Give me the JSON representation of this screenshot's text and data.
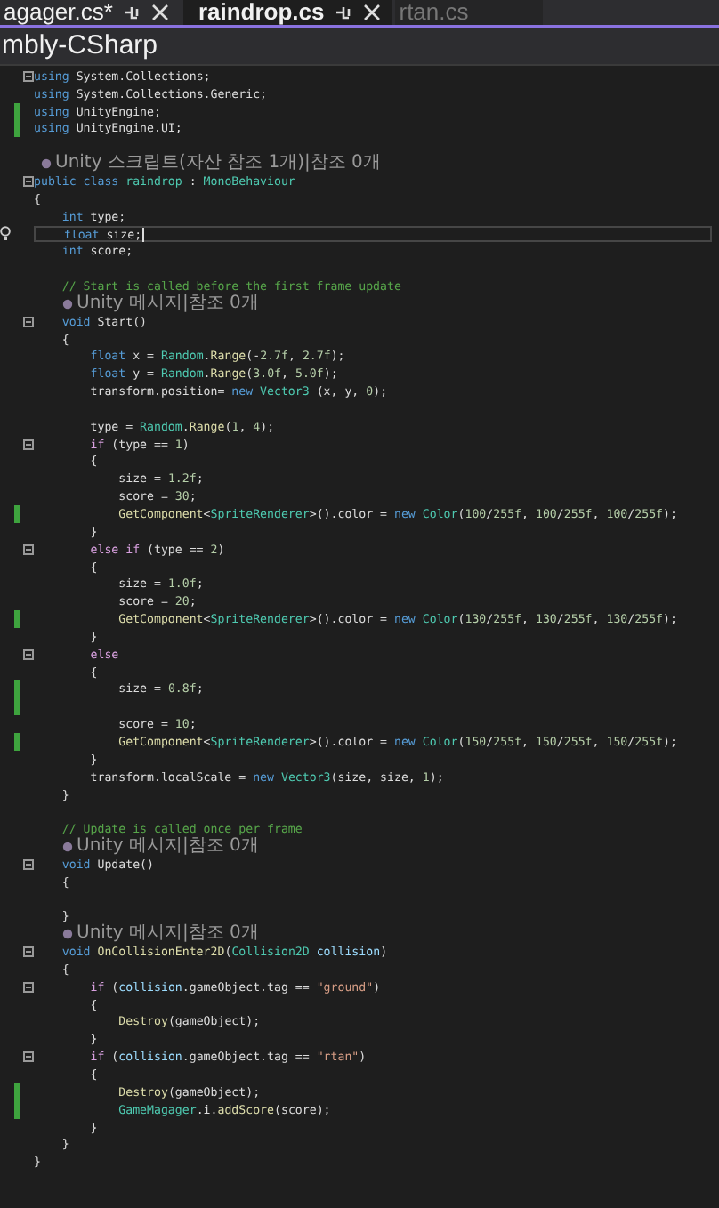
{
  "tabs": [
    {
      "label": "agager.cs*",
      "selected": false,
      "controls": true
    },
    {
      "label": "raindrop.cs",
      "selected": true,
      "controls": true
    },
    {
      "label": "rtan.cs",
      "selected": false,
      "controls": false
    }
  ],
  "project": "mbly-CSharp",
  "lines": [
    {
      "kind": "code",
      "fold": true,
      "changed": false,
      "current": false,
      "tokens": [
        {
          "kind": "kw",
          "text": "using"
        },
        {
          "kind": "plain",
          "text": " System.Collections;"
        }
      ]
    },
    {
      "kind": "code",
      "fold": false,
      "changed": false,
      "current": false,
      "tokens": [
        {
          "kind": "kw",
          "text": "using"
        },
        {
          "kind": "plain",
          "text": " System.Collections.Generic;"
        }
      ]
    },
    {
      "kind": "code",
      "fold": false,
      "changed": true,
      "current": false,
      "tokens": [
        {
          "kind": "kw",
          "text": "using"
        },
        {
          "kind": "plain",
          "text": " UnityEngine;"
        }
      ]
    },
    {
      "kind": "code",
      "fold": false,
      "changed": true,
      "current": false,
      "tokens": [
        {
          "kind": "kw",
          "text": "using"
        },
        {
          "kind": "plain",
          "text": " UnityEngine.UI;"
        }
      ]
    },
    {
      "kind": "blank"
    },
    {
      "kind": "lens",
      "text": " Unity 스크립트(자산 참조 1개)|참조 0개"
    },
    {
      "kind": "code",
      "fold": true,
      "changed": false,
      "current": false,
      "tokens": [
        {
          "kind": "kw",
          "text": "public class "
        },
        {
          "kind": "type",
          "text": "raindrop"
        },
        {
          "kind": "plain",
          "text": " : "
        },
        {
          "kind": "type",
          "text": "MonoBehaviour"
        }
      ]
    },
    {
      "kind": "code",
      "fold": false,
      "changed": false,
      "current": false,
      "tokens": [
        {
          "kind": "plain",
          "text": "{"
        }
      ]
    },
    {
      "kind": "code",
      "fold": false,
      "changed": false,
      "current": false,
      "tokens": [
        {
          "kind": "kw",
          "text": "    int"
        },
        {
          "kind": "plain",
          "text": " type;"
        }
      ]
    },
    {
      "kind": "code",
      "fold": false,
      "changed": false,
      "current": true,
      "tokens": [
        {
          "kind": "kw",
          "text": "    float"
        },
        {
          "kind": "plain",
          "text": " size;"
        }
      ]
    },
    {
      "kind": "code",
      "fold": false,
      "changed": false,
      "current": false,
      "tokens": [
        {
          "kind": "kw",
          "text": "    int"
        },
        {
          "kind": "plain",
          "text": " score;"
        }
      ]
    },
    {
      "kind": "blank"
    },
    {
      "kind": "code",
      "fold": false,
      "changed": false,
      "current": false,
      "tokens": [
        {
          "kind": "comment",
          "text": "    // Start is called before the first frame update"
        }
      ]
    },
    {
      "kind": "lens",
      "text": "    Unity 메시지|참조 0개"
    },
    {
      "kind": "code",
      "fold": true,
      "changed": false,
      "current": false,
      "tokens": [
        {
          "kind": "kw",
          "text": "    void"
        },
        {
          "kind": "plain",
          "text": " Start()"
        }
      ]
    },
    {
      "kind": "code",
      "fold": false,
      "changed": false,
      "current": false,
      "tokens": [
        {
          "kind": "plain",
          "text": "    {"
        }
      ]
    },
    {
      "kind": "code",
      "fold": false,
      "changed": false,
      "current": false,
      "tokens": [
        {
          "kind": "kw",
          "text": "        float"
        },
        {
          "kind": "plain",
          "text": " x = "
        },
        {
          "kind": "type",
          "text": "Random"
        },
        {
          "kind": "plain",
          "text": "."
        },
        {
          "kind": "fn",
          "text": "Range"
        },
        {
          "kind": "plain",
          "text": "(-"
        },
        {
          "kind": "num",
          "text": "2.7f"
        },
        {
          "kind": "plain",
          "text": ", "
        },
        {
          "kind": "num",
          "text": "2.7f"
        },
        {
          "kind": "plain",
          "text": ");"
        }
      ]
    },
    {
      "kind": "code",
      "fold": false,
      "changed": false,
      "current": false,
      "tokens": [
        {
          "kind": "kw",
          "text": "        float"
        },
        {
          "kind": "plain",
          "text": " y = "
        },
        {
          "kind": "type",
          "text": "Random"
        },
        {
          "kind": "plain",
          "text": "."
        },
        {
          "kind": "fn",
          "text": "Range"
        },
        {
          "kind": "plain",
          "text": "("
        },
        {
          "kind": "num",
          "text": "3.0f"
        },
        {
          "kind": "plain",
          "text": ", "
        },
        {
          "kind": "num",
          "text": "5.0f"
        },
        {
          "kind": "plain",
          "text": ");"
        }
      ]
    },
    {
      "kind": "code",
      "fold": false,
      "changed": false,
      "current": false,
      "tokens": [
        {
          "kind": "plain",
          "text": "        transform.position= "
        },
        {
          "kind": "kw",
          "text": "new "
        },
        {
          "kind": "type",
          "text": "Vector3"
        },
        {
          "kind": "plain",
          "text": " (x, y, "
        },
        {
          "kind": "num",
          "text": "0"
        },
        {
          "kind": "plain",
          "text": ");"
        }
      ]
    },
    {
      "kind": "blank"
    },
    {
      "kind": "code",
      "fold": false,
      "changed": false,
      "current": false,
      "tokens": [
        {
          "kind": "plain",
          "text": "        type = "
        },
        {
          "kind": "type",
          "text": "Random"
        },
        {
          "kind": "plain",
          "text": "."
        },
        {
          "kind": "fn",
          "text": "Range"
        },
        {
          "kind": "plain",
          "text": "("
        },
        {
          "kind": "num",
          "text": "1"
        },
        {
          "kind": "plain",
          "text": ", "
        },
        {
          "kind": "num",
          "text": "4"
        },
        {
          "kind": "plain",
          "text": ");"
        }
      ]
    },
    {
      "kind": "code",
      "fold": true,
      "changed": false,
      "current": false,
      "tokens": [
        {
          "kind": "control",
          "text": "        if"
        },
        {
          "kind": "plain",
          "text": " (type == "
        },
        {
          "kind": "num",
          "text": "1"
        },
        {
          "kind": "plain",
          "text": ")"
        }
      ]
    },
    {
      "kind": "code",
      "fold": false,
      "changed": false,
      "current": false,
      "tokens": [
        {
          "kind": "plain",
          "text": "        {"
        }
      ]
    },
    {
      "kind": "code",
      "fold": false,
      "changed": false,
      "current": false,
      "tokens": [
        {
          "kind": "plain",
          "text": "            size = "
        },
        {
          "kind": "num",
          "text": "1.2f"
        },
        {
          "kind": "plain",
          "text": ";"
        }
      ]
    },
    {
      "kind": "code",
      "fold": false,
      "changed": false,
      "current": false,
      "tokens": [
        {
          "kind": "plain",
          "text": "            score = "
        },
        {
          "kind": "num",
          "text": "30"
        },
        {
          "kind": "plain",
          "text": ";"
        }
      ]
    },
    {
      "kind": "code",
      "fold": false,
      "changed": true,
      "current": false,
      "tokens": [
        {
          "kind": "fn",
          "text": "            GetComponent"
        },
        {
          "kind": "plain",
          "text": "<"
        },
        {
          "kind": "type",
          "text": "SpriteRenderer"
        },
        {
          "kind": "plain",
          "text": ">().color = "
        },
        {
          "kind": "kw",
          "text": "new "
        },
        {
          "kind": "type",
          "text": "Color"
        },
        {
          "kind": "plain",
          "text": "("
        },
        {
          "kind": "num",
          "text": "100"
        },
        {
          "kind": "plain",
          "text": "/"
        },
        {
          "kind": "num",
          "text": "255f"
        },
        {
          "kind": "plain",
          "text": ", "
        },
        {
          "kind": "num",
          "text": "100"
        },
        {
          "kind": "plain",
          "text": "/"
        },
        {
          "kind": "num",
          "text": "255f"
        },
        {
          "kind": "plain",
          "text": ", "
        },
        {
          "kind": "num",
          "text": "100"
        },
        {
          "kind": "plain",
          "text": "/"
        },
        {
          "kind": "num",
          "text": "255f"
        },
        {
          "kind": "plain",
          "text": ");"
        }
      ]
    },
    {
      "kind": "code",
      "fold": false,
      "changed": false,
      "current": false,
      "tokens": [
        {
          "kind": "plain",
          "text": "        }"
        }
      ]
    },
    {
      "kind": "code",
      "fold": true,
      "changed": false,
      "current": false,
      "tokens": [
        {
          "kind": "control",
          "text": "        else if"
        },
        {
          "kind": "plain",
          "text": " (type == "
        },
        {
          "kind": "num",
          "text": "2"
        },
        {
          "kind": "plain",
          "text": ")"
        }
      ]
    },
    {
      "kind": "code",
      "fold": false,
      "changed": false,
      "current": false,
      "tokens": [
        {
          "kind": "plain",
          "text": "        {"
        }
      ]
    },
    {
      "kind": "code",
      "fold": false,
      "changed": false,
      "current": false,
      "tokens": [
        {
          "kind": "plain",
          "text": "            size = "
        },
        {
          "kind": "num",
          "text": "1.0f"
        },
        {
          "kind": "plain",
          "text": ";"
        }
      ]
    },
    {
      "kind": "code",
      "fold": false,
      "changed": false,
      "current": false,
      "tokens": [
        {
          "kind": "plain",
          "text": "            score = "
        },
        {
          "kind": "num",
          "text": "20"
        },
        {
          "kind": "plain",
          "text": ";"
        }
      ]
    },
    {
      "kind": "code",
      "fold": false,
      "changed": true,
      "current": false,
      "tokens": [
        {
          "kind": "fn",
          "text": "            GetComponent"
        },
        {
          "kind": "plain",
          "text": "<"
        },
        {
          "kind": "type",
          "text": "SpriteRenderer"
        },
        {
          "kind": "plain",
          "text": ">().color = "
        },
        {
          "kind": "kw",
          "text": "new "
        },
        {
          "kind": "type",
          "text": "Color"
        },
        {
          "kind": "plain",
          "text": "("
        },
        {
          "kind": "num",
          "text": "130"
        },
        {
          "kind": "plain",
          "text": "/"
        },
        {
          "kind": "num",
          "text": "255f"
        },
        {
          "kind": "plain",
          "text": ", "
        },
        {
          "kind": "num",
          "text": "130"
        },
        {
          "kind": "plain",
          "text": "/"
        },
        {
          "kind": "num",
          "text": "255f"
        },
        {
          "kind": "plain",
          "text": ", "
        },
        {
          "kind": "num",
          "text": "130"
        },
        {
          "kind": "plain",
          "text": "/"
        },
        {
          "kind": "num",
          "text": "255f"
        },
        {
          "kind": "plain",
          "text": ");"
        }
      ]
    },
    {
      "kind": "code",
      "fold": false,
      "changed": false,
      "current": false,
      "tokens": [
        {
          "kind": "plain",
          "text": "        }"
        }
      ]
    },
    {
      "kind": "code",
      "fold": true,
      "changed": false,
      "current": false,
      "tokens": [
        {
          "kind": "control",
          "text": "        else"
        }
      ]
    },
    {
      "kind": "code",
      "fold": false,
      "changed": false,
      "current": false,
      "tokens": [
        {
          "kind": "plain",
          "text": "        {"
        }
      ]
    },
    {
      "kind": "code",
      "fold": false,
      "changed": true,
      "current": false,
      "tokens": [
        {
          "kind": "plain",
          "text": "            size = "
        },
        {
          "kind": "num",
          "text": "0.8f"
        },
        {
          "kind": "plain",
          "text": ";"
        }
      ]
    },
    {
      "kind": "blank",
      "changed": true
    },
    {
      "kind": "code",
      "fold": false,
      "changed": false,
      "current": false,
      "tokens": [
        {
          "kind": "plain",
          "text": "            score = "
        },
        {
          "kind": "num",
          "text": "10"
        },
        {
          "kind": "plain",
          "text": ";"
        }
      ]
    },
    {
      "kind": "code",
      "fold": false,
      "changed": true,
      "current": false,
      "tokens": [
        {
          "kind": "fn",
          "text": "            GetComponent"
        },
        {
          "kind": "plain",
          "text": "<"
        },
        {
          "kind": "type",
          "text": "SpriteRenderer"
        },
        {
          "kind": "plain",
          "text": ">().color = "
        },
        {
          "kind": "kw",
          "text": "new "
        },
        {
          "kind": "type",
          "text": "Color"
        },
        {
          "kind": "plain",
          "text": "("
        },
        {
          "kind": "num",
          "text": "150"
        },
        {
          "kind": "plain",
          "text": "/"
        },
        {
          "kind": "num",
          "text": "255f"
        },
        {
          "kind": "plain",
          "text": ", "
        },
        {
          "kind": "num",
          "text": "150"
        },
        {
          "kind": "plain",
          "text": "/"
        },
        {
          "kind": "num",
          "text": "255f"
        },
        {
          "kind": "plain",
          "text": ", "
        },
        {
          "kind": "num",
          "text": "150"
        },
        {
          "kind": "plain",
          "text": "/"
        },
        {
          "kind": "num",
          "text": "255f"
        },
        {
          "kind": "plain",
          "text": ");"
        }
      ]
    },
    {
      "kind": "code",
      "fold": false,
      "changed": false,
      "current": false,
      "tokens": [
        {
          "kind": "plain",
          "text": "        }"
        }
      ]
    },
    {
      "kind": "code",
      "fold": false,
      "changed": false,
      "current": false,
      "tokens": [
        {
          "kind": "plain",
          "text": "        transform.localScale = "
        },
        {
          "kind": "kw",
          "text": "new "
        },
        {
          "kind": "type",
          "text": "Vector3"
        },
        {
          "kind": "plain",
          "text": "(size, size, "
        },
        {
          "kind": "num",
          "text": "1"
        },
        {
          "kind": "plain",
          "text": ");"
        }
      ]
    },
    {
      "kind": "code",
      "fold": false,
      "changed": false,
      "current": false,
      "tokens": [
        {
          "kind": "plain",
          "text": "    }"
        }
      ]
    },
    {
      "kind": "blank"
    },
    {
      "kind": "code",
      "fold": false,
      "changed": false,
      "current": false,
      "tokens": [
        {
          "kind": "comment",
          "text": "    // Update is called once per frame"
        }
      ]
    },
    {
      "kind": "lens",
      "text": "    Unity 메시지|참조 0개"
    },
    {
      "kind": "code",
      "fold": true,
      "changed": false,
      "current": false,
      "tokens": [
        {
          "kind": "kw",
          "text": "    void"
        },
        {
          "kind": "plain",
          "text": " Update()"
        }
      ]
    },
    {
      "kind": "code",
      "fold": false,
      "changed": false,
      "current": false,
      "tokens": [
        {
          "kind": "plain",
          "text": "    {"
        }
      ]
    },
    {
      "kind": "blank"
    },
    {
      "kind": "code",
      "fold": false,
      "changed": false,
      "current": false,
      "tokens": [
        {
          "kind": "plain",
          "text": "    }"
        }
      ]
    },
    {
      "kind": "lens",
      "text": "    Unity 메시지|참조 0개"
    },
    {
      "kind": "code",
      "fold": true,
      "changed": false,
      "current": false,
      "tokens": [
        {
          "kind": "kw",
          "text": "    void"
        },
        {
          "kind": "fn",
          "text": " OnCollisionEnter2D"
        },
        {
          "kind": "plain",
          "text": "("
        },
        {
          "kind": "type",
          "text": "Collision2D"
        },
        {
          "kind": "var",
          "text": " collision"
        },
        {
          "kind": "plain",
          "text": ")"
        }
      ]
    },
    {
      "kind": "code",
      "fold": false,
      "changed": false,
      "current": false,
      "tokens": [
        {
          "kind": "plain",
          "text": "    {"
        }
      ]
    },
    {
      "kind": "code",
      "fold": true,
      "changed": false,
      "current": false,
      "tokens": [
        {
          "kind": "control",
          "text": "        if"
        },
        {
          "kind": "plain",
          "text": " ("
        },
        {
          "kind": "var",
          "text": "collision"
        },
        {
          "kind": "plain",
          "text": ".gameObject.tag == "
        },
        {
          "kind": "string",
          "text": "\"ground\""
        },
        {
          "kind": "plain",
          "text": ")"
        }
      ]
    },
    {
      "kind": "code",
      "fold": false,
      "changed": false,
      "current": false,
      "tokens": [
        {
          "kind": "plain",
          "text": "        {"
        }
      ]
    },
    {
      "kind": "code",
      "fold": false,
      "changed": false,
      "current": false,
      "tokens": [
        {
          "kind": "fn",
          "text": "            Destroy"
        },
        {
          "kind": "plain",
          "text": "(gameObject);"
        }
      ]
    },
    {
      "kind": "code",
      "fold": false,
      "changed": false,
      "current": false,
      "tokens": [
        {
          "kind": "plain",
          "text": "        }"
        }
      ]
    },
    {
      "kind": "code",
      "fold": true,
      "changed": false,
      "current": false,
      "tokens": [
        {
          "kind": "control",
          "text": "        if"
        },
        {
          "kind": "plain",
          "text": " ("
        },
        {
          "kind": "var",
          "text": "collision"
        },
        {
          "kind": "plain",
          "text": ".gameObject.tag == "
        },
        {
          "kind": "string",
          "text": "\"rtan\""
        },
        {
          "kind": "plain",
          "text": ")"
        }
      ]
    },
    {
      "kind": "code",
      "fold": false,
      "changed": false,
      "current": false,
      "tokens": [
        {
          "kind": "plain",
          "text": "        {"
        }
      ]
    },
    {
      "kind": "code",
      "fold": false,
      "changed": true,
      "current": false,
      "tokens": [
        {
          "kind": "fn",
          "text": "            Destroy"
        },
        {
          "kind": "plain",
          "text": "(gameObject);"
        }
      ]
    },
    {
      "kind": "code",
      "fold": false,
      "changed": true,
      "current": false,
      "tokens": [
        {
          "kind": "type",
          "text": "            GameMagager"
        },
        {
          "kind": "plain",
          "text": ".i."
        },
        {
          "kind": "fn",
          "text": "addScore"
        },
        {
          "kind": "plain",
          "text": "(score);"
        }
      ]
    },
    {
      "kind": "code",
      "fold": false,
      "changed": false,
      "current": false,
      "tokens": [
        {
          "kind": "plain",
          "text": "        }"
        }
      ]
    },
    {
      "kind": "code",
      "fold": false,
      "changed": false,
      "current": false,
      "tokens": [
        {
          "kind": "plain",
          "text": "    }"
        }
      ]
    },
    {
      "kind": "code",
      "fold": false,
      "changed": false,
      "current": false,
      "tokens": [
        {
          "kind": "plain",
          "text": "}"
        }
      ]
    }
  ]
}
